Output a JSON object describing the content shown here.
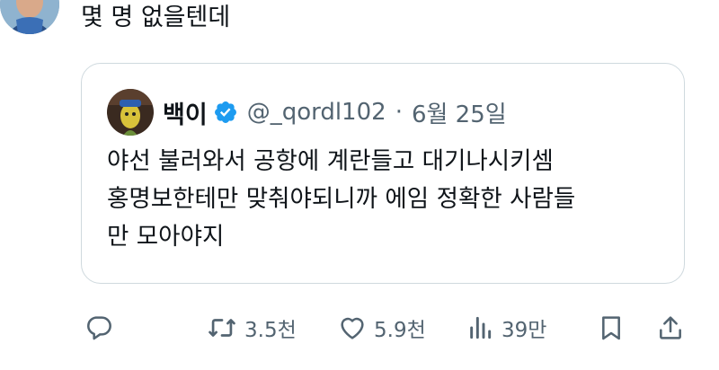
{
  "post": {
    "text": "몇 명 없을텐데"
  },
  "quoted": {
    "name": "백이",
    "handle": "@_qordl102",
    "dot": "·",
    "date": "6월 25일",
    "lines": [
      "야선 불러와서 공항에 계란들고 대기나시키셈",
      "홍명보한테만 맞춰야되니까 에임 정확한 사람들",
      "만 모아야지"
    ]
  },
  "actions": {
    "retweets": "3.5천",
    "likes": "5.9천",
    "views": "39만"
  },
  "colors": {
    "text": "#0f1419",
    "secondary": "#536471",
    "verified": "#1d9bf0",
    "border": "#cfd9de"
  }
}
